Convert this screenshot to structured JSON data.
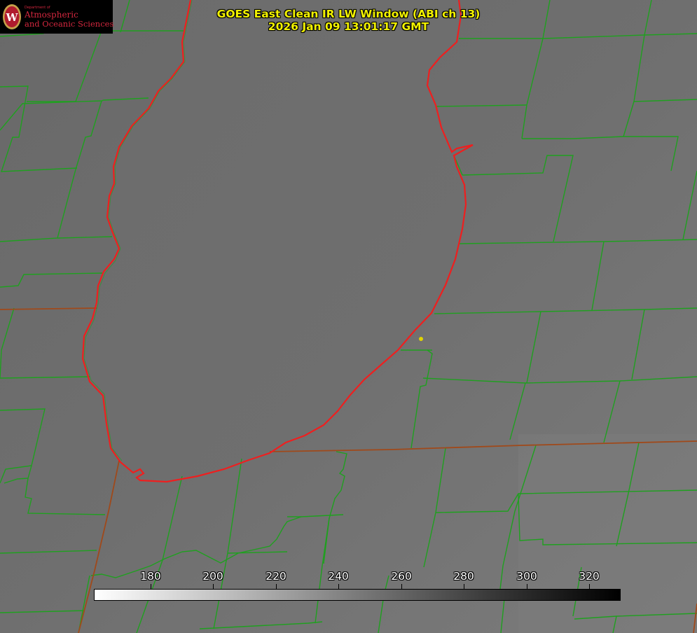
{
  "title": {
    "line1": "GOES East Clean IR LW Window (ABI ch 13)",
    "line2": "2026 Jan 09 13:01:17 GMT"
  },
  "logo": {
    "department_line": "Department of",
    "line1": "Atmospheric",
    "line2": "and Oceanic Sciences",
    "seal_letter": "W",
    "color": "#d3273e",
    "seal_color": "#c5a14a"
  },
  "colorbar": {
    "min": 162,
    "max": 330,
    "ticks": [
      180,
      200,
      220,
      240,
      260,
      280,
      300,
      320
    ],
    "gradient_stops": [
      "#ffffff",
      "#bfbfbf",
      "#7a7a7a",
      "#3a3a3a",
      "#000000"
    ]
  },
  "map": {
    "county_line_color": "#1fa01f",
    "state_line_color": "#a0491a",
    "lake_shore_color": "#ee1f1f",
    "marker_color": "#e0d400",
    "background_gray": "#6e6e6e"
  }
}
